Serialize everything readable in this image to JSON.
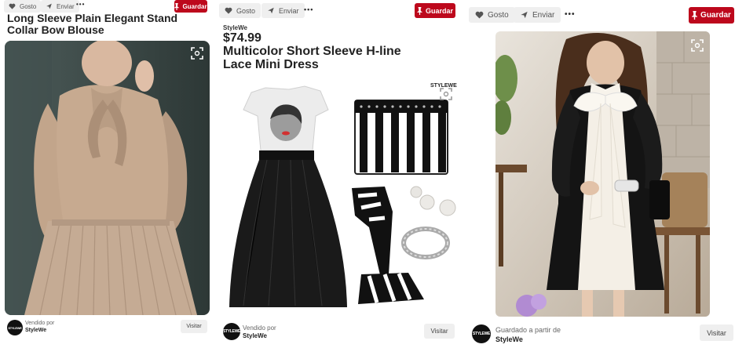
{
  "pins": [
    {
      "like_label": "Gosto",
      "send_label": "Enviar",
      "more_label": "•••",
      "save_label": "Guardar",
      "title": "Long Sleeve Plain Elegant Stand Collar Bow Blouse",
      "image_alt": "Woman wearing a beige long sleeve bow blouse and pleated skirt",
      "footer_prefix": "Vendido por",
      "footer_name": "StyleWe",
      "avatar_text": "STYLEWE",
      "visit_label": "Visitar"
    },
    {
      "like_label": "Gosto",
      "send_label": "Enviar",
      "more_label": "•••",
      "save_label": "Guardar",
      "seller": "StyleWe",
      "price": "$74.99",
      "title": "Multicolor Short Sleeve H-line Lace Mini Dress",
      "watermark": "STYLEWE",
      "image_alt": "Product collage: printed tee dress with black tulle skirt, striped clutch, striped heels and jewelry",
      "footer_prefix": "Vendido por",
      "footer_name": "StyleWe",
      "avatar_text": "STYLEWE",
      "visit_label": "Visitar"
    },
    {
      "like_label": "Gosto",
      "send_label": "Enviar",
      "more_label": "•••",
      "save_label": "Guardar",
      "image_alt": "Woman wearing a black and white bow dress",
      "footer_prefix": "Guardado a partir de",
      "footer_name": "StyleWe",
      "avatar_text": "STYLEWE",
      "visit_label": "Visitar"
    }
  ],
  "colors": {
    "save_red": "#bd081c",
    "button_gray": "#efefef"
  }
}
